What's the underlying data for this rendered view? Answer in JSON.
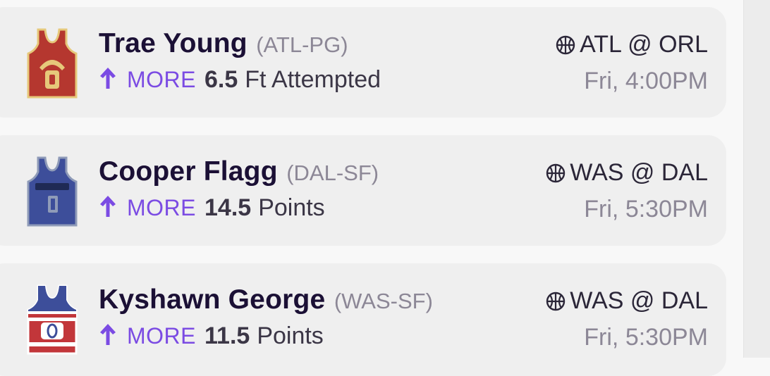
{
  "picks": [
    {
      "player": "Trae Young",
      "position": "(ATL-PG)",
      "direction": "MORE",
      "line": "6.5",
      "stat": "Ft Attempted",
      "matchup": "ATL @ ORL",
      "time": "Fri, 4:00PM",
      "jersey": {
        "body": "#b5372f",
        "trim": "#e6c87a",
        "number_color": "#e6c87a"
      }
    },
    {
      "player": "Cooper Flagg",
      "position": "(DAL-SF)",
      "direction": "MORE",
      "line": "14.5",
      "stat": "Points",
      "matchup": "WAS @ DAL",
      "time": "Fri, 5:30PM",
      "jersey": {
        "body": "#3d4e9a",
        "trim": "#8f9bb8",
        "number_color": "#8f9bb8"
      }
    },
    {
      "player": "Kyshawn George",
      "position": "(WAS-SF)",
      "direction": "MORE",
      "line": "11.5",
      "stat": "Points",
      "matchup": "WAS @ DAL",
      "time": "Fri, 5:30PM",
      "jersey": {
        "body": "#c2363a",
        "trim": "#ffffff",
        "number_color": "#3d4e9a"
      }
    }
  ],
  "colors": {
    "accent": "#7b4be3",
    "card_bg": "#efefef",
    "page_bg": "#f8f8f8"
  },
  "icons": {
    "arrow": "arrow-up-icon",
    "sport": "basketball-icon",
    "jersey": "jersey-icon"
  }
}
